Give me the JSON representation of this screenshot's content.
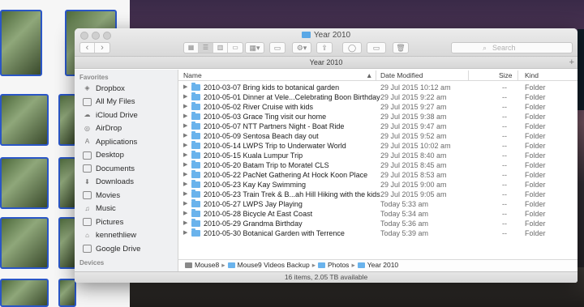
{
  "window": {
    "title": "Year 2010",
    "path_title": "Year 2010"
  },
  "toolbar": {
    "back_glyph": "‹",
    "forward_glyph": "›",
    "view_icons": [
      "icon-view-icon",
      "list-view-icon",
      "column-view-icon",
      "coverflow-view-icon"
    ],
    "search_placeholder": "Search"
  },
  "sidebar": {
    "favorites_header": "Favorites",
    "items": [
      {
        "label": "Dropbox",
        "icon": "dropbox-icon"
      },
      {
        "label": "All My Files",
        "icon": "all-files-icon"
      },
      {
        "label": "iCloud Drive",
        "icon": "cloud-icon"
      },
      {
        "label": "AirDrop",
        "icon": "airdrop-icon"
      },
      {
        "label": "Applications",
        "icon": "applications-icon"
      },
      {
        "label": "Desktop",
        "icon": "desktop-icon"
      },
      {
        "label": "Documents",
        "icon": "documents-icon"
      },
      {
        "label": "Downloads",
        "icon": "downloads-icon"
      },
      {
        "label": "Movies",
        "icon": "movies-icon"
      },
      {
        "label": "Music",
        "icon": "music-icon"
      },
      {
        "label": "Pictures",
        "icon": "pictures-icon"
      },
      {
        "label": "kennethliew",
        "icon": "home-icon"
      },
      {
        "label": "Google Drive",
        "icon": "google-drive-icon"
      }
    ],
    "devices_header": "Devices"
  },
  "columns": {
    "name": "Name",
    "date": "Date Modified",
    "size": "Size",
    "kind": "Kind"
  },
  "rows": [
    {
      "name": "2010-03-07 Bring kids to botanical garden",
      "date": "29 Jul 2015 10:12 am",
      "size": "--",
      "kind": "Folder"
    },
    {
      "name": "2010-05-01 Dinner at Vele...Celebrating Boon Birthday",
      "date": "29 Jul 2015 9:22 am",
      "size": "--",
      "kind": "Folder"
    },
    {
      "name": "2010-05-02 River Cruise with kids",
      "date": "29 Jul 2015 9:27 am",
      "size": "--",
      "kind": "Folder"
    },
    {
      "name": "2010-05-03 Grace Ting visit our home",
      "date": "29 Jul 2015 9:38 am",
      "size": "--",
      "kind": "Folder"
    },
    {
      "name": "2010-05-07 NTT Partners Night - Boat Ride",
      "date": "29 Jul 2015 9:47 am",
      "size": "--",
      "kind": "Folder"
    },
    {
      "name": "2010-05-09 Sentosa Beach day out",
      "date": "29 Jul 2015 9:52 am",
      "size": "--",
      "kind": "Folder"
    },
    {
      "name": "2010-05-14 LWPS Trip to Underwater World",
      "date": "29 Jul 2015 10:02 am",
      "size": "--",
      "kind": "Folder"
    },
    {
      "name": "2010-05-15 Kuala Lumpur Trip",
      "date": "29 Jul 2015 8:40 am",
      "size": "--",
      "kind": "Folder"
    },
    {
      "name": "2010-05-20 Batam Trip to Moratel CLS",
      "date": "29 Jul 2015 8:45 am",
      "size": "--",
      "kind": "Folder"
    },
    {
      "name": "2010-05-22 PacNet Gathering At Hock Koon Place",
      "date": "29 Jul 2015 8:53 am",
      "size": "--",
      "kind": "Folder"
    },
    {
      "name": "2010-05-23 Kay Kay Swimming",
      "date": "29 Jul 2015 9:00 am",
      "size": "--",
      "kind": "Folder"
    },
    {
      "name": "2010-05-23 Train Trek & B...ah Hill Hiking with the kids",
      "date": "29 Jul 2015 9:05 am",
      "size": "--",
      "kind": "Folder"
    },
    {
      "name": "2010-05-27 LWPS Jay Playing",
      "date": "Today 5:33 am",
      "size": "--",
      "kind": "Folder"
    },
    {
      "name": "2010-05-28 Bicycle At East Coast",
      "date": "Today 5:34 am",
      "size": "--",
      "kind": "Folder"
    },
    {
      "name": "2010-05-29 Grandma Birthday",
      "date": "Today 5:36 am",
      "size": "--",
      "kind": "Folder"
    },
    {
      "name": "2010-05-30 Botanical Garden with Terrence",
      "date": "Today 5:39 am",
      "size": "--",
      "kind": "Folder"
    }
  ],
  "breadcrumb": [
    "Mouse8",
    "Mouse9 Videos Backup",
    "Photos",
    "Year 2010"
  ],
  "status": "16 items, 2.05 TB available",
  "colors": {
    "accent": "#2a56c6",
    "folder": "#6ab3ec"
  }
}
